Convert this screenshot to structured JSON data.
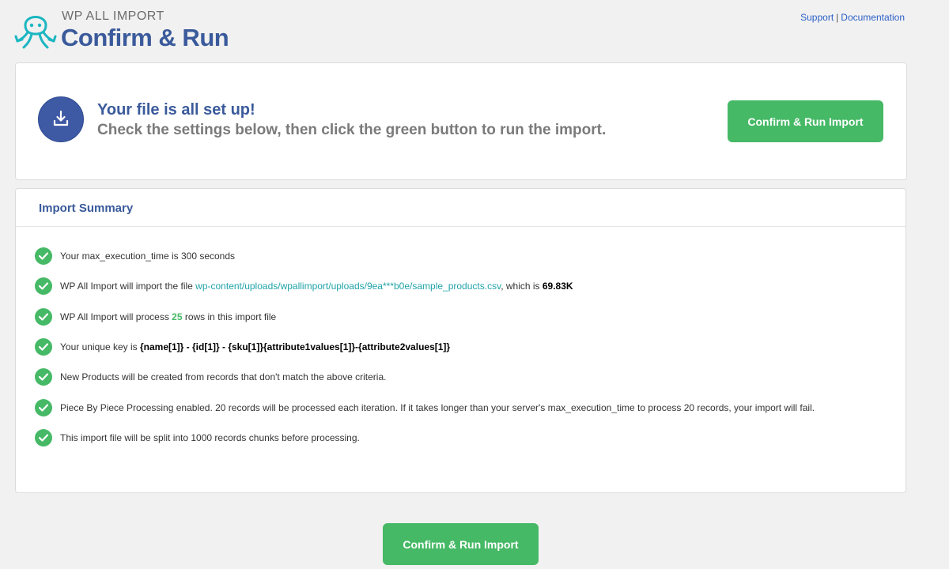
{
  "header": {
    "brand": "WP ALL IMPORT",
    "title": "Confirm & Run",
    "links": {
      "support": "Support",
      "separator": "|",
      "documentation": "Documentation"
    }
  },
  "setup": {
    "heading": "Your file is all set up!",
    "subheading": "Check the settings below, then click the green button to run the import.",
    "button_label": "Confirm & Run Import"
  },
  "summary": {
    "title": "Import Summary",
    "items": [
      {
        "text": "Your max_execution_time is 300 seconds"
      },
      {
        "pre": "WP All Import will import the file ",
        "link": "wp-content/uploads/wpallimport/uploads/9ea***b0e/sample_products.csv",
        "mid": ", which is ",
        "bold": "69.83K"
      },
      {
        "pre": "WP All Import will process ",
        "num": "25",
        "post": " rows in this import file"
      },
      {
        "pre": "Your unique key is ",
        "bold": "{name[1]} - {id[1]} - {sku[1]}{attribute1values[1]}-{attribute2values[1]}"
      },
      {
        "text": "New Products will be created from records that don't match the above criteria."
      },
      {
        "text": "Piece By Piece Processing enabled. 20 records will be processed each iteration. If it takes longer than your server's max_execution_time to process 20 records, your import will fail."
      },
      {
        "text": "This import file will be split into 1000 records chunks before processing."
      }
    ]
  },
  "footer": {
    "button_label": "Confirm & Run Import"
  },
  "colors": {
    "accent_blue": "#3a5a9b",
    "green": "#46b966",
    "link_teal": "#20a3a8",
    "logo_teal": "#1bb6c1"
  }
}
